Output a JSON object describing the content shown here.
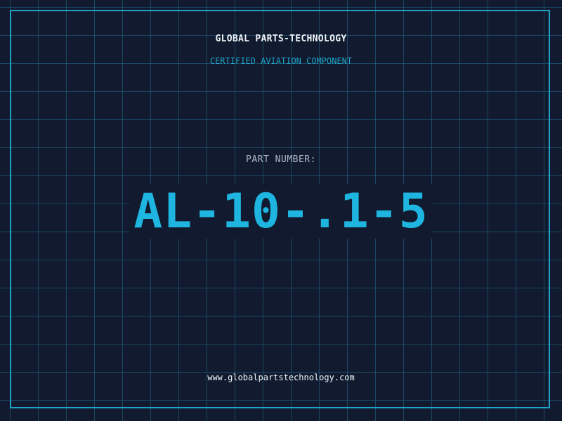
{
  "header": {
    "company": "GLOBAL PARTS-TECHNOLOGY",
    "subtitle": "CERTIFIED AVIATION COMPONENT"
  },
  "part": {
    "label": "PART NUMBER:",
    "number": "AL-10-.1-5"
  },
  "footer": {
    "website": "www.globalpartstechnology.com"
  },
  "colors": {
    "background": "#111a2e",
    "grid": "#226e8a",
    "accent": "#1eb5e0",
    "text": "#eef3f8",
    "muted": "#aeb8c6"
  }
}
